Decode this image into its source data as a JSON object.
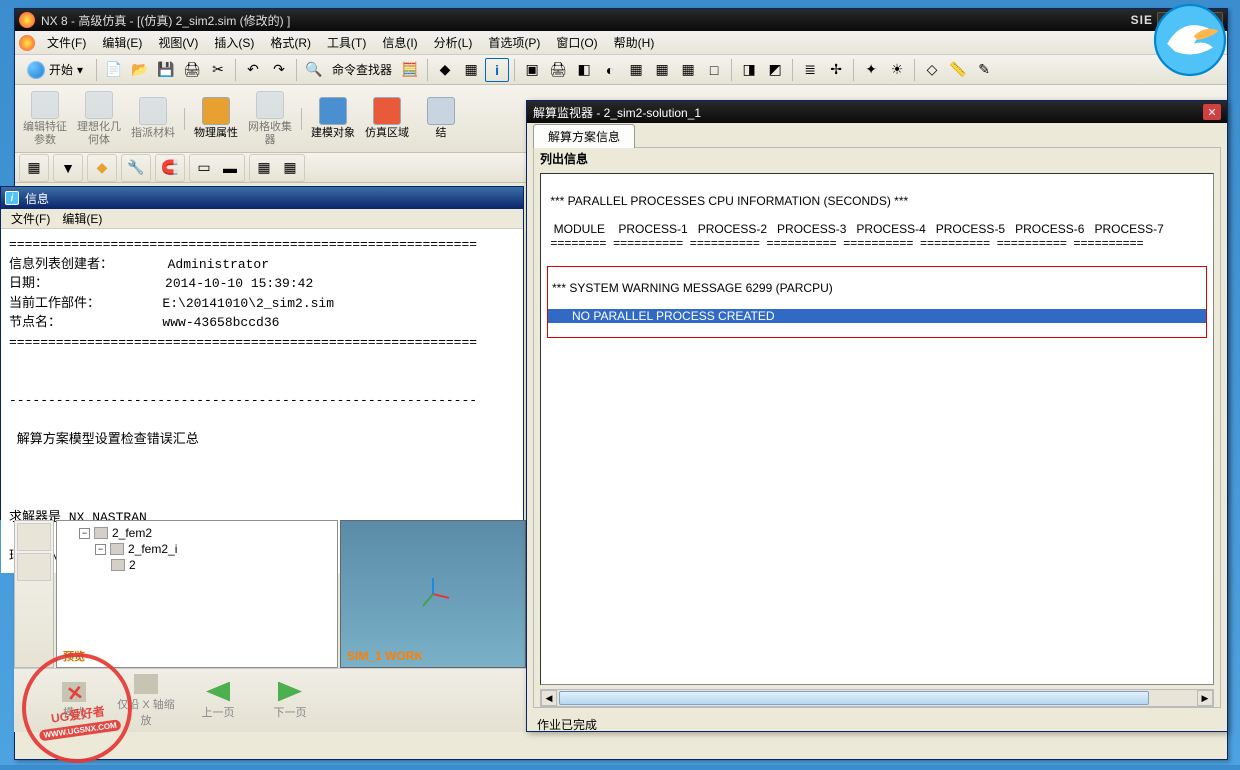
{
  "app": {
    "title": "NX 8 - 高级仿真 - [(仿真) 2_sim2.sim (修改的) ]",
    "brand": "SIE"
  },
  "menu": {
    "file": "文件(F)",
    "edit": "编辑(E)",
    "view": "视图(V)",
    "insert": "插入(S)",
    "format": "格式(R)",
    "tools": "工具(T)",
    "info": "信息(I)",
    "analysis": "分析(L)",
    "preferences": "首选项(P)",
    "window": "窗口(O)",
    "help": "帮助(H)"
  },
  "toolbar": {
    "start": "开始",
    "command_finder": "命令查找器"
  },
  "ribbon": {
    "b1": "编辑特征参数",
    "b2": "理想化几何体",
    "b3": "指派材料",
    "b4": "物理属性",
    "b5": "网格收集器",
    "b6": "建模对象",
    "b7": "仿真区域",
    "b8": "结"
  },
  "info_window": {
    "title": "信息",
    "menu_file": "文件(F)",
    "menu_edit": "编辑(E)",
    "body": "============================================================\n信息列表创建者：       Administrator\n日期：               2014-10-10 15:39:42\n当前工作部件：        E:\\20141010\\2_sim2.sim\n节点名：             www-43658bccd36\n============================================================\n\n\n------------------------------------------------------------\n\n 解算方案模型设置检查错误汇总\n\n\n\n求解器是 NX NASTRAN\n\n环境: NX NASTRAN - Structural\n"
  },
  "tree": {
    "n1": "2_fem2",
    "n2": "2_fem2_i",
    "n3": "2"
  },
  "preview_label": "预览",
  "viewport_label": "SIM_1 WORK",
  "nav": {
    "b1": "模式",
    "b2": "仅沿 X 轴缩放",
    "b3": "上一页",
    "b4": "下一页"
  },
  "solver": {
    "title": "解算监视器 - 2_sim2-solution_1",
    "tab": "解算方案信息",
    "group": "列出信息",
    "text_header": " *** PARALLEL PROCESSES CPU INFORMATION (SECONDS) ***\n\n  MODULE    PROCESS-1   PROCESS-2   PROCESS-3   PROCESS-4   PROCESS-5   PROCESS-6   PROCESS-7\n ========  ==========  ==========  ==========  ==========  ==========  ==========  ==========",
    "warn1": "*** SYSTEM WARNING MESSAGE 6299 (PARCPU)",
    "warn2": "NO PARALLEL PROCESS CREATED",
    "status": "作业已完成"
  },
  "stamp": {
    "tag": "UG爱好者",
    "url": "WWW.UGSNX.COM"
  }
}
